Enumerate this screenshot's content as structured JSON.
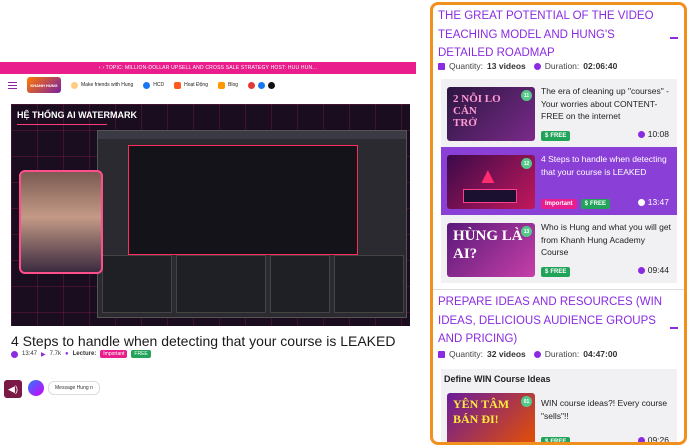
{
  "left": {
    "promo": "‹ › TOPIC: MILLION-DOLLAR UPSELL AND CROSS SALE STRATEGY HOST: HUU HUN...",
    "logo_text": "KHANH HUNG",
    "nav": [
      "Make friends with Hung",
      "HCD",
      "Hoạt Động",
      "Blog"
    ],
    "video_watermark": "HỆ THỐNG AI WATERMARK",
    "video_title": "4 Steps to handle when detecting that your course is LEAKED",
    "meta_time": "13:47",
    "meta_views": "7.7k",
    "meta_lecture_label": "Lecture:",
    "badge_important": "Important",
    "badge_free": "FREE",
    "messenger_placeholder": "Message Hung n"
  },
  "sections": [
    {
      "title": "THE GREAT POTENTIAL OF THE VIDEO TEACHING MODEL AND HUNG'S DETAILED ROADMAP",
      "quantity_label": "Quantity:",
      "quantity": "13 videos",
      "duration_label": "Duration:",
      "duration": "02:06:40"
    },
    {
      "title": "PREPARE IDEAS AND RESOURCES (WIN IDEAS, DELICIOUS AUDIENCE GROUPS AND PRICING)",
      "quantity_label": "Quantity:",
      "quantity": "32 videos",
      "duration_label": "Duration:",
      "duration": "04:47:00",
      "subsection": "Define WIN Course Ideas"
    }
  ],
  "lessons": [
    {
      "num": "11",
      "thumb_text": "2 NỖI LO CẢN TRỞ",
      "title": "The era of cleaning up \"courses\" - Your worries about CONTENT-FREE on the internet",
      "free": "FREE",
      "duration": "10:08"
    },
    {
      "num": "12",
      "thumb_text": "",
      "title": "4 Steps to handle when detecting that your course is LEAKED",
      "important": "Important",
      "free": "FREE",
      "duration": "13:47"
    },
    {
      "num": "13",
      "thumb_text": "HÙNG LÀ AI?",
      "title": "Who is Hung and what you will get from Khanh Hung Academy Course",
      "free": "FREE",
      "duration": "09:44"
    },
    {
      "num": "01",
      "thumb_text": "YÊN TÂM BÁN ĐI!",
      "title": "WIN course ideas?! Every course \"sells\"!!",
      "free": "FREE",
      "duration": "09:26"
    }
  ],
  "colors": {
    "accent": "#8a2be2",
    "active": "#8a3fd6",
    "border": "#f0901e",
    "free": "#22a35a",
    "important": "#e91e8c"
  }
}
